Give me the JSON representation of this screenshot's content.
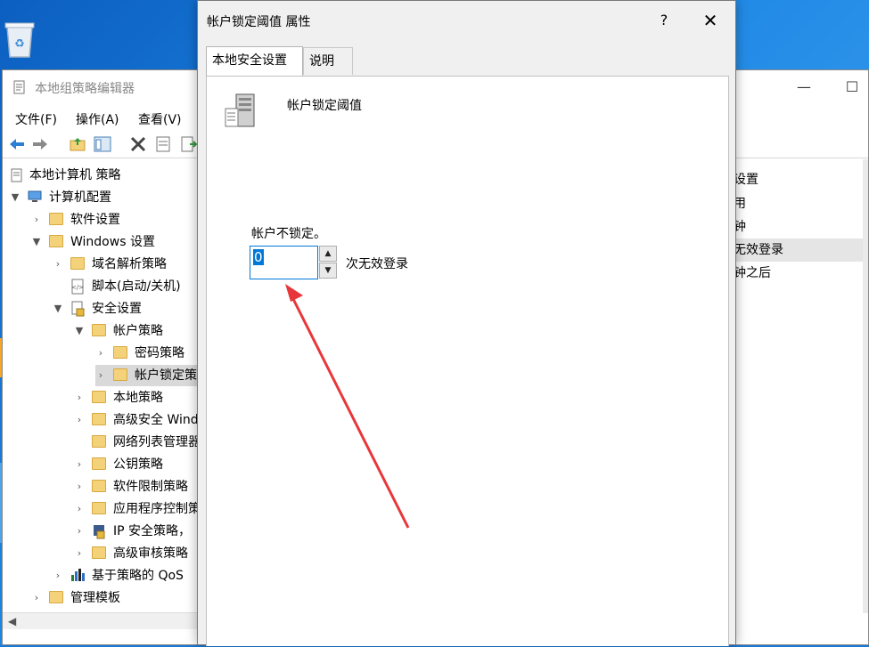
{
  "main_window": {
    "title": "本地组策略编辑器",
    "controls": {
      "minimize": "—",
      "maximize": "☐"
    },
    "menu": [
      "文件(F)",
      "操作(A)",
      "查看(V)"
    ],
    "tree": [
      {
        "label": "本地计算机 策略",
        "icon": "policy-icon",
        "expanded": null
      },
      {
        "label": "计算机配置",
        "icon": "computer-icon",
        "expanded": true
      },
      {
        "label": "软件设置",
        "icon": "folder-icon",
        "expanded": false
      },
      {
        "label": "Windows 设置",
        "icon": "folder-icon",
        "expanded": true
      },
      {
        "label": "域名解析策略",
        "icon": "folder-icon",
        "expanded": false
      },
      {
        "label": "脚本(启动/关机)",
        "icon": "script-icon",
        "expanded": null
      },
      {
        "label": "安全设置",
        "icon": "security-icon",
        "expanded": true
      },
      {
        "label": "帐户策略",
        "icon": "lock-folder-icon",
        "expanded": true
      },
      {
        "label": "密码策略",
        "icon": "lock-folder-icon",
        "expanded": false
      },
      {
        "label": "帐户锁定策略",
        "icon": "lock-folder-icon",
        "expanded": false
      },
      {
        "label": "本地策略",
        "icon": "lock-folder-icon",
        "expanded": false
      },
      {
        "label": "高级安全 Windows",
        "icon": "folder-icon",
        "expanded": false
      },
      {
        "label": "网络列表管理器策略",
        "icon": "folder-icon",
        "expanded": null
      },
      {
        "label": "公钥策略",
        "icon": "folder-icon",
        "expanded": false
      },
      {
        "label": "软件限制策略",
        "icon": "folder-icon",
        "expanded": false
      },
      {
        "label": "应用程序控制策略",
        "icon": "folder-icon",
        "expanded": false
      },
      {
        "label": "IP 安全策略，",
        "icon": "ip-security-icon",
        "expanded": false
      },
      {
        "label": "高级审核策略",
        "icon": "folder-icon",
        "expanded": false
      },
      {
        "label": "基于策略的 QoS",
        "icon": "qos-chart-icon",
        "expanded": false
      },
      {
        "label": "管理模板",
        "icon": "folder-icon",
        "expanded": false
      }
    ],
    "right_pane": [
      "设置",
      "用",
      "钟",
      "无效登录",
      "钟之后"
    ],
    "selected_tree_item": "帐户锁定策略"
  },
  "dialog": {
    "title": "帐户锁定阈值 属性",
    "help_label": "?",
    "close_label": "✕",
    "tabs": [
      "本地安全设置",
      "说明"
    ],
    "active_tab": 0,
    "policy_name": "帐户锁定阈值",
    "description": "帐户不锁定。",
    "value": "0",
    "unit_label": "次无效登录"
  },
  "accent_color": "#0078d7",
  "annotation_arrow_color": "#e8373a"
}
